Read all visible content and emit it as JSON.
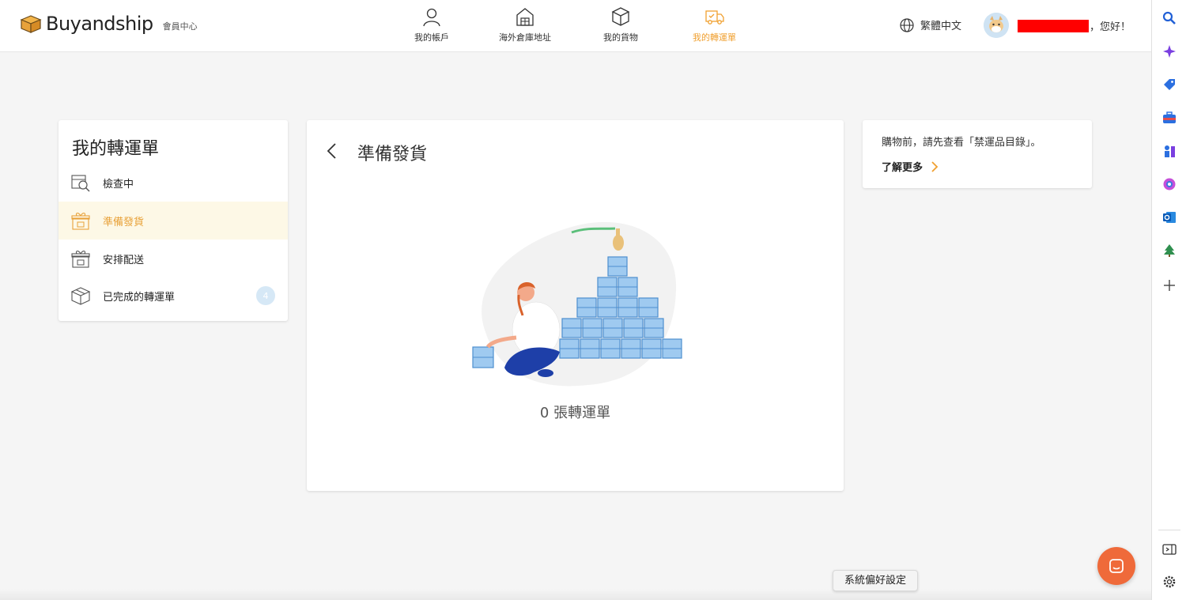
{
  "header": {
    "logo_text": "Buyandship",
    "logo_sub": "會員中心",
    "nav": [
      {
        "label": "我的帳戶",
        "icon": "user-icon"
      },
      {
        "label": "海外倉庫地址",
        "icon": "warehouse-icon"
      },
      {
        "label": "我的貨物",
        "icon": "box-icon"
      },
      {
        "label": "我的轉運單",
        "icon": "truck-icon",
        "active": true
      }
    ],
    "language": "繁體中文",
    "greeting": "，您好！"
  },
  "sidebar_menu": {
    "title": "我的轉運單",
    "items": [
      {
        "label": "檢查中",
        "icon": "inspect-icon"
      },
      {
        "label": "準備發貨",
        "icon": "gift-box-icon",
        "active": true
      },
      {
        "label": "安排配送",
        "icon": "gift-box-icon"
      },
      {
        "label": "已完成的轉運單",
        "icon": "package-icon",
        "badge": "4"
      }
    ]
  },
  "main": {
    "title": "準備發貨",
    "count_text": "0 張轉運單"
  },
  "info": {
    "text": "購物前，請先查看「禁運品目錄」。",
    "link": "了解更多"
  },
  "tooltip": "系統偏好設定",
  "colors": {
    "accent": "#f0a030",
    "active_bg": "#fdf8e6",
    "chat": "#ef6a3a",
    "badge": "#d6e8f6"
  }
}
